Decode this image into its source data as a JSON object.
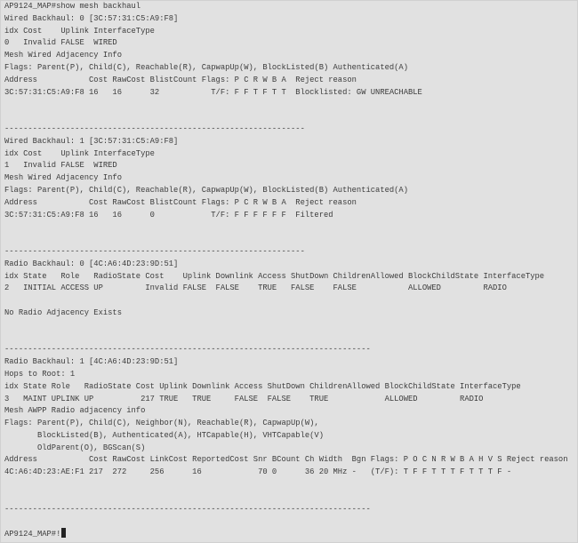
{
  "terminal": {
    "lines": [
      "AP9124_MAP#show mesh backhaul",
      "Wired Backhaul: 0 [3C:57:31:C5:A9:F8]",
      "idx Cost    Uplink InterfaceType",
      "0   Invalid FALSE  WIRED",
      "Mesh Wired Adjacency Info",
      "Flags: Parent(P), Child(C), Reachable(R), CapwapUp(W), BlockListed(B) Authenticated(A)",
      "Address           Cost RawCost BlistCount Flags: P C R W B A  Reject reason",
      "3C:57:31:C5:A9:F8 16   16      32           T/F: F F T F T T  Blocklisted: GW UNREACHABLE",
      "",
      "",
      "----------------------------------------------------------------",
      "Wired Backhaul: 1 [3C:57:31:C5:A9:F8]",
      "idx Cost    Uplink InterfaceType",
      "1   Invalid FALSE  WIRED",
      "Mesh Wired Adjacency Info",
      "Flags: Parent(P), Child(C), Reachable(R), CapwapUp(W), BlockListed(B) Authenticated(A)",
      "Address           Cost RawCost BlistCount Flags: P C R W B A  Reject reason",
      "3C:57:31:C5:A9:F8 16   16      0            T/F: F F F F F F  Filtered",
      "",
      "",
      "----------------------------------------------------------------",
      "Radio Backhaul: 0 [4C:A6:4D:23:9D:51]",
      "idx State   Role   RadioState Cost    Uplink Downlink Access ShutDown ChildrenAllowed BlockChildState InterfaceType",
      "2   INITIAL ACCESS UP         Invalid FALSE  FALSE    TRUE   FALSE    FALSE           ALLOWED         RADIO",
      "",
      "No Radio Adjacency Exists",
      "",
      "",
      "------------------------------------------------------------------------------",
      "Radio Backhaul: 1 [4C:A6:4D:23:9D:51]",
      "Hops to Root: 1",
      "idx State Role   RadioState Cost Uplink Downlink Access ShutDown ChildrenAllowed BlockChildState InterfaceType",
      "3   MAINT UPLINK UP          217 TRUE   TRUE     FALSE  FALSE    TRUE            ALLOWED         RADIO",
      "Mesh AWPP Radio adjacency info",
      "Flags: Parent(P), Child(C), Neighbor(N), Reachable(R), CapwapUp(W),",
      "       BlockListed(B), Authenticated(A), HTCapable(H), VHTCapable(V)",
      "       OldParent(O), BGScan(S)",
      "Address           Cost RawCost LinkCost ReportedCost Snr BCount Ch Width  Bgn Flags: P O C N R W B A H V S Reject reason",
      "4C:A6:4D:23:AE:F1 217  272     256      16            70 0      36 20 MHz -   (T/F): T F F T T T F T T T F -",
      "",
      "",
      "------------------------------------------------------------------------------",
      ""
    ],
    "prompt": "AP9124_MAP#!"
  }
}
